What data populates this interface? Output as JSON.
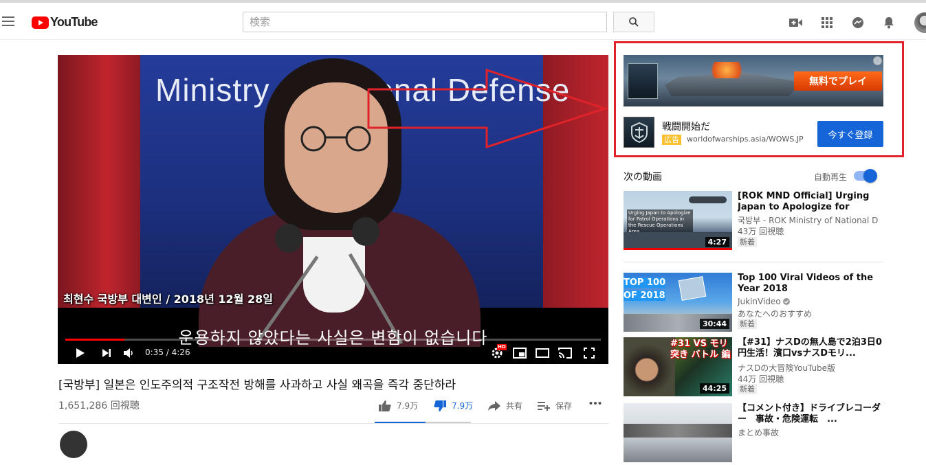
{
  "header": {
    "logo_text": "YouTube",
    "search_placeholder": "検索"
  },
  "player": {
    "title_on_screen": "Ministry of National Defense",
    "caption_overlay": "최현수 국방부 대변인 / 2018년 12월 28일",
    "subtitle": "운용하지 않았다는 사실은 변함이 없습니다",
    "time_current": "0:35",
    "time_total": "4:26",
    "time_separator": " / ",
    "progress": 0.11,
    "hd_badge": "HD"
  },
  "ad": {
    "banner_cta": "無料でプレイ",
    "info_icon": "i",
    "title": "戦闘開始だ",
    "badge": "広告",
    "url": "worldofwarships.asia/WOWS.JP",
    "cta": "今すぐ登録"
  },
  "upnext": {
    "title": "次の動画",
    "autoplay_label": "自動再生",
    "autoplay_on": true,
    "items": [
      {
        "title": "[ROK MND Official] Urging Japan to Apologize for Patrol...",
        "channel": "국방부 - ROK Ministry of National D",
        "meta": "43万 回視聴",
        "badge": "新着",
        "duration": "4:27",
        "thumb_caption": "Urging Japan to Apologize for Patrol Operations in the Rescue Operations Area"
      },
      {
        "title": "Top 100 Viral Videos of the Year 2018",
        "channel": "JukinVideo",
        "meta": "あなたへのおすすめ",
        "badge": "新着",
        "duration": "30:44",
        "thumb_caption": "TOP 100 OF 2018"
      },
      {
        "title": "【#31】ナスDの無人島で2泊3日0円生活！濱口vsナスDモリ...",
        "channel": "ナスDの大冒険YouTube版",
        "meta": "44万 回視聴",
        "badge": "新着",
        "duration": "44:25",
        "thumb_caption": "#31 VS モリ突き バトル 編"
      },
      {
        "title": "【コメント付き】ドライブレコーダー　事故・危険運転　...",
        "channel": "まとめ事故",
        "meta": "",
        "badge": "",
        "duration": "",
        "thumb_caption": ""
      }
    ]
  },
  "video": {
    "title": "[국방부] 일본은 인도주의적 구조작전 방해를 사과하고 사실 왜곡을 즉각 중단하라",
    "views": "1,651,286 回視聴",
    "likes": "7.9万",
    "dislikes": "7.9万",
    "share": "共有",
    "save": "保存",
    "like_ratio": 0.53
  },
  "colors": {
    "brand_red": "#ff0000",
    "highlight_red": "#e0232a",
    "accent_blue": "#1565d8",
    "ad_badge_yellow": "#fbc02d"
  }
}
